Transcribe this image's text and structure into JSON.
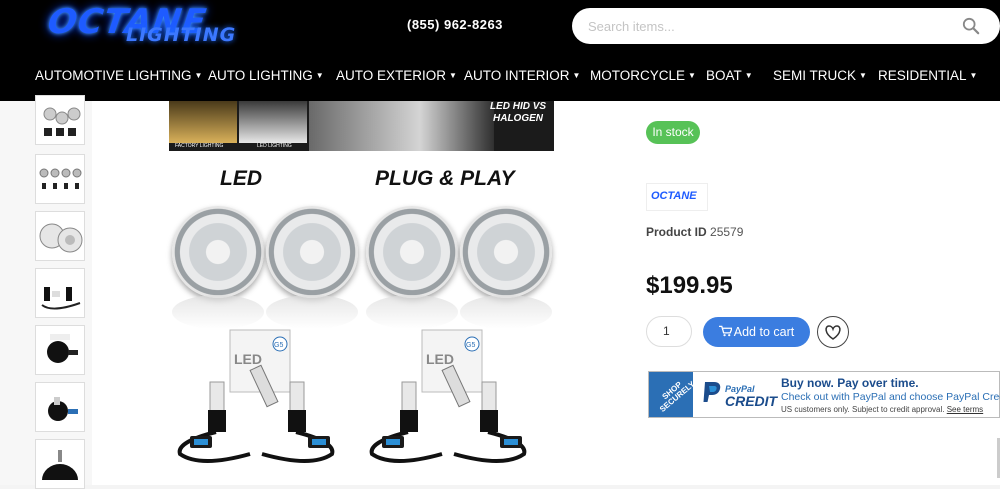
{
  "header": {
    "logo_main": "OCTANE",
    "logo_sub": "LIGHTING",
    "phone": "(855) 962-8263",
    "search": {
      "placeholder": "Search items..."
    }
  },
  "nav": [
    {
      "label": "AUTOMOTIVE LIGHTING"
    },
    {
      "label": "AUTO LIGHTING"
    },
    {
      "label": "AUTO EXTERIOR"
    },
    {
      "label": "AUTO INTERIOR"
    },
    {
      "label": "MOTORCYCLE"
    },
    {
      "label": "BOAT"
    },
    {
      "label": "SEMI TRUCK"
    },
    {
      "label": "RESIDENTIAL"
    }
  ],
  "gallery": {
    "banner_label": "LED HID VS HALOGEN",
    "banner_captions": [
      "FACTORY LIGHTING",
      "LED LIGHTING"
    ],
    "title_left": "LED",
    "title_right": "PLUG & PLAY",
    "kit_badge": "G5",
    "kit_box_text": "LED"
  },
  "product": {
    "stock_label": "In stock",
    "brand_logo": "OCTANE",
    "product_id_label": "Product ID",
    "product_id": "25579",
    "price": "$199.95",
    "quantity": "1",
    "add_to_cart_label": "Add to cart"
  },
  "paypal": {
    "ribbon": "SHOP SECURELY",
    "paypal": "PayPal",
    "credit": "CREDIT",
    "headline": "Buy now. Pay over time.",
    "subline": "Check out with PayPal and choose PayPal Credit.",
    "fine_print": "US customers only. Subject to credit approval.",
    "terms_link": "See terms"
  },
  "colors": {
    "header_bg": "#000000",
    "stock_green": "#57c257",
    "cart_blue": "#3b7de0",
    "paypal_blue": "#2b6fb5"
  }
}
